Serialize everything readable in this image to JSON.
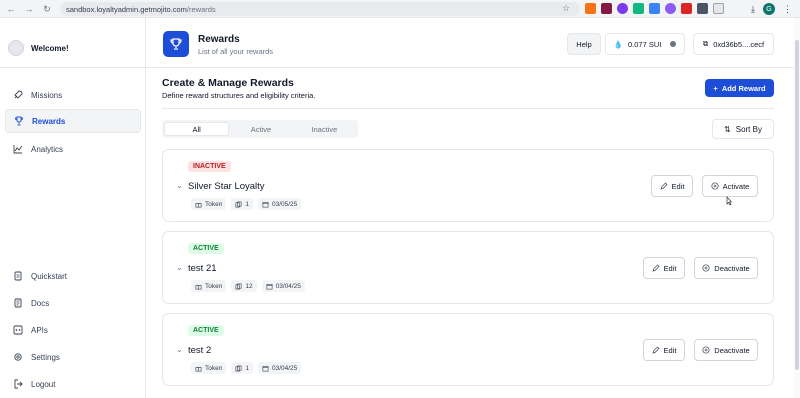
{
  "browser": {
    "url_host": "sandbox.loyaltyadmin.getmojito.com",
    "url_path": "/rewards",
    "profile_initial": "G"
  },
  "sidebar": {
    "welcome": "Welcome!",
    "items": [
      {
        "label": "Missions",
        "icon": "rocket-icon"
      },
      {
        "label": "Rewards",
        "icon": "trophy-icon",
        "active": true
      },
      {
        "label": "Analytics",
        "icon": "chart-line-icon"
      }
    ],
    "bottom_items": [
      {
        "label": "Quickstart",
        "icon": "doc-icon"
      },
      {
        "label": "Docs",
        "icon": "book-icon"
      },
      {
        "label": "APIs",
        "icon": "code-icon"
      },
      {
        "label": "Settings",
        "icon": "gear-icon"
      },
      {
        "label": "Logout",
        "icon": "logout-icon"
      }
    ]
  },
  "header": {
    "title": "Rewards",
    "subtitle": "List of all your rewards",
    "help": "Help",
    "balance": "0.077 SUI",
    "wallet": "0xd36b5....cecf"
  },
  "main": {
    "title": "Create & Manage Rewards",
    "subtitle": "Define reward structures and eligibility criteria.",
    "add_button": "Add Reward",
    "tabs": [
      "All",
      "Active",
      "Inactive"
    ],
    "sort_label": "Sort By"
  },
  "rewards": [
    {
      "status": "INACTIVE",
      "name": "Silver Star Loyalty",
      "type": "Token",
      "count": "1",
      "date": "03/05/25",
      "edit": "Edit",
      "action": "Activate"
    },
    {
      "status": "ACTIVE",
      "name": "test 21",
      "type": "Token",
      "count": "12",
      "date": "03/04/25",
      "edit": "Edit",
      "action": "Deactivate"
    },
    {
      "status": "ACTIVE",
      "name": "test 2",
      "type": "Token",
      "count": "1",
      "date": "03/04/25",
      "edit": "Edit",
      "action": "Deactivate"
    }
  ],
  "colors": {
    "accent": "#1d4ed8",
    "inactive_badge": "#fee2e2",
    "active_badge": "#dcfce7"
  }
}
